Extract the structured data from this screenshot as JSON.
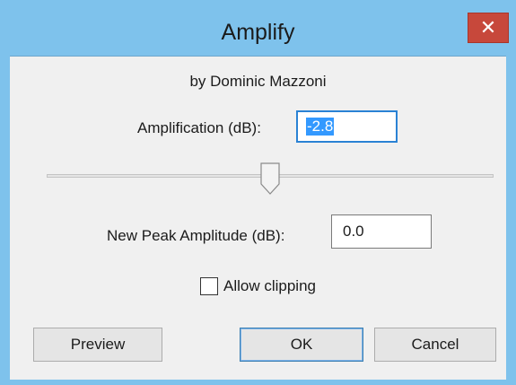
{
  "window": {
    "title": "Amplify",
    "close_symbol": "✕"
  },
  "dialog": {
    "author": "by Dominic Mazzoni",
    "amplification_label": "Amplification (dB):",
    "amplification_value": "-2.8",
    "slider_level": 0.5,
    "new_peak_label": "New Peak Amplitude (dB):",
    "new_peak_value": "0.0",
    "allow_clipping_label": "Allow clipping",
    "allow_clipping_checked": false
  },
  "buttons": {
    "preview": "Preview",
    "ok": "OK",
    "cancel": "Cancel"
  },
  "icons": {
    "close": "close-icon",
    "slider_thumb": "slider-thumb-icon"
  },
  "colors": {
    "titlebar": "#7ec2ec",
    "close_button": "#c7483b",
    "client_bg": "#f0f0f0",
    "selection": "#3399ff"
  }
}
